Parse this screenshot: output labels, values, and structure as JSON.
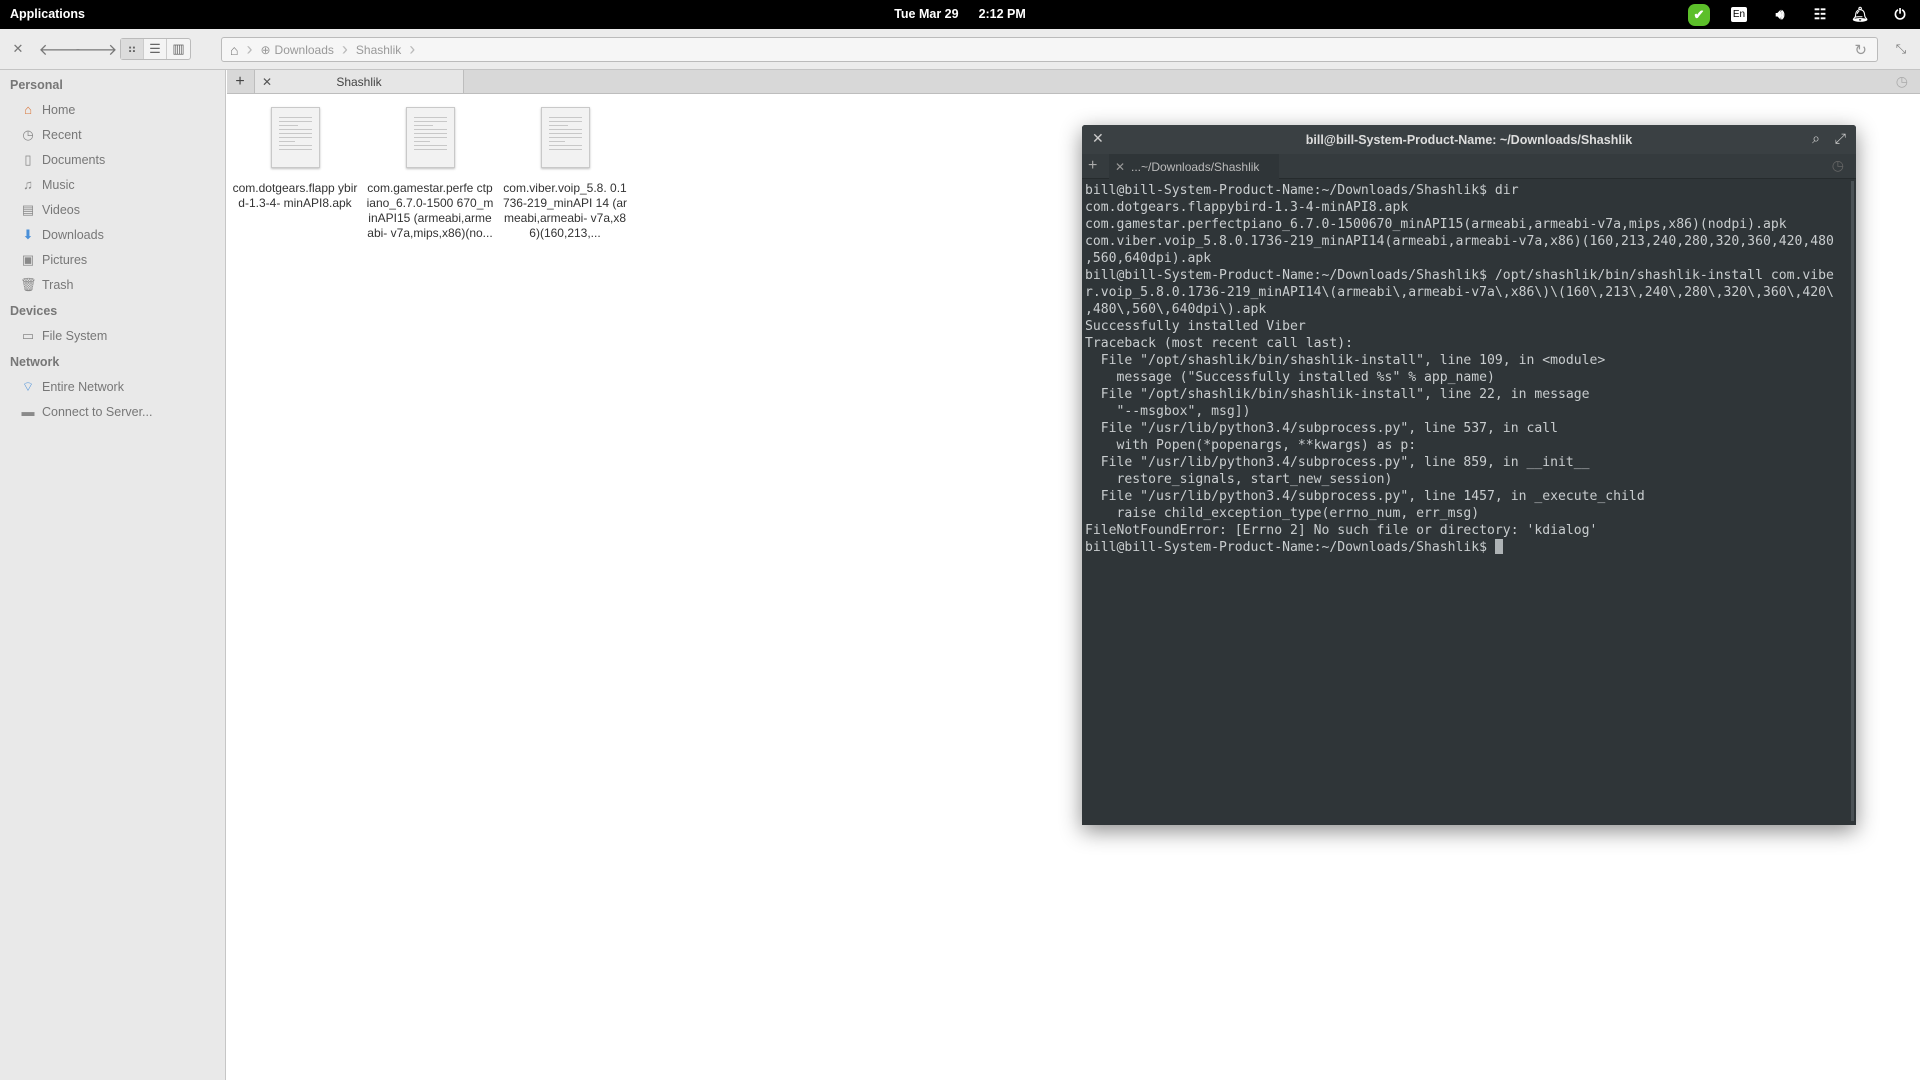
{
  "topbar": {
    "applications": "Applications",
    "date": "Tue Mar 29",
    "time": "2:12 PM",
    "keyboard_layout": "En",
    "tray_icons": [
      "skype-icon",
      "keyboard-layout-icon",
      "volume-icon",
      "network-icon",
      "notifications-icon",
      "power-icon"
    ],
    "skype_color": "#5cbf2a"
  },
  "toolbar": {
    "breadcrumb": [
      "Downloads",
      "Shashlik"
    ]
  },
  "sidebar": {
    "sections": [
      {
        "title": "Personal",
        "items": [
          {
            "label": "Home",
            "icon": "home-icon"
          },
          {
            "label": "Recent",
            "icon": "recent-icon"
          },
          {
            "label": "Documents",
            "icon": "document-icon"
          },
          {
            "label": "Music",
            "icon": "music-icon"
          },
          {
            "label": "Videos",
            "icon": "video-icon"
          },
          {
            "label": "Downloads",
            "icon": "download-icon"
          },
          {
            "label": "Pictures",
            "icon": "pictures-icon"
          },
          {
            "label": "Trash",
            "icon": "trash-icon"
          }
        ]
      },
      {
        "title": "Devices",
        "items": [
          {
            "label": "File System",
            "icon": "drive-icon"
          }
        ]
      },
      {
        "title": "Network",
        "items": [
          {
            "label": "Entire Network",
            "icon": "wifi-icon"
          },
          {
            "label": "Connect to Server...",
            "icon": "server-icon"
          }
        ]
      }
    ]
  },
  "tabs": {
    "active": "Shashlik"
  },
  "files": [
    {
      "name": "com.dotgears.flappybird-1.3-4-minAPI8.apk",
      "label": "com.dotgears.flapp ybird-1.3-4- minAPI8.apk"
    },
    {
      "name": "com.gamestar.perfectpiano_6.7.0-1500670_minAPI15(armeabi,armeabi-v7a,mips,x86)(nodpi).apk",
      "label": "com.gamestar.perfe ctpiano_6.7.0-1500 670_minAPI15 (armeabi,armeabi- v7a,mips,x86)(no..."
    },
    {
      "name": "com.viber.voip_5.8.0.1736-219_minAPI14(armeabi,armeabi-v7a,x86)(160,213,240,280,320,360,420,480,560,640dpi).apk",
      "label": "com.viber.voip_5.8. 0.1736-219_minAPI 14 (armeabi,armeabi- v7a,x86)(160,213,..."
    }
  ],
  "terminal": {
    "title": "bill@bill-System-Product-Name: ~/Downloads/Shashlik",
    "tab": "...~/Downloads/Shashlik",
    "output": "bill@bill-System-Product-Name:~/Downloads/Shashlik$ dir\ncom.dotgears.flappybird-1.3-4-minAPI8.apk\ncom.gamestar.perfectpiano_6.7.0-1500670_minAPI15(armeabi,armeabi-v7a,mips,x86)(nodpi).apk\ncom.viber.voip_5.8.0.1736-219_minAPI14(armeabi,armeabi-v7a,x86)(160,213,240,280,320,360,420,480\n,560,640dpi).apk\nbill@bill-System-Product-Name:~/Downloads/Shashlik$ /opt/shashlik/bin/shashlik-install com.vibe\nr.voip_5.8.0.1736-219_minAPI14\\(armeabi\\,armeabi-v7a\\,x86\\)\\(160\\,213\\,240\\,280\\,320\\,360\\,420\\\n,480\\,560\\,640dpi\\).apk\nSuccessfully installed Viber\nTraceback (most recent call last):\n  File \"/opt/shashlik/bin/shashlik-install\", line 109, in <module>\n    message (\"Successfully installed %s\" % app_name)\n  File \"/opt/shashlik/bin/shashlik-install\", line 22, in message\n    \"--msgbox\", msg])\n  File \"/usr/lib/python3.4/subprocess.py\", line 537, in call\n    with Popen(*popenargs, **kwargs) as p:\n  File \"/usr/lib/python3.4/subprocess.py\", line 859, in __init__\n    restore_signals, start_new_session)\n  File \"/usr/lib/python3.4/subprocess.py\", line 1457, in _execute_child\n    raise child_exception_type(errno_num, err_msg)\nFileNotFoundError: [Errno 2] No such file or directory: 'kdialog'\n",
    "prompt": "bill@bill-System-Product-Name:~/Downloads/Shashlik$ "
  }
}
